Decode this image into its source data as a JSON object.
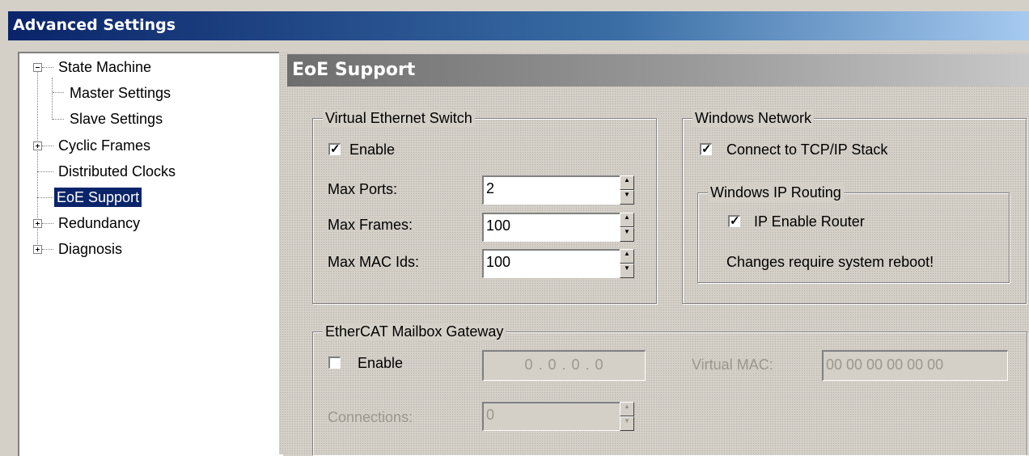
{
  "window": {
    "title": "Advanced Settings"
  },
  "tree": {
    "items": [
      {
        "label": "State Machine"
      },
      {
        "label": "Master Settings"
      },
      {
        "label": "Slave Settings"
      },
      {
        "label": "Cyclic Frames"
      },
      {
        "label": "Distributed Clocks"
      },
      {
        "label": "EoE Support"
      },
      {
        "label": "Redundancy"
      },
      {
        "label": "Diagnosis"
      }
    ]
  },
  "panel": {
    "title": "EoE Support"
  },
  "ves": {
    "title": "Virtual Ethernet Switch",
    "enable_label": "Enable",
    "enable_checked": true,
    "max_ports_label": "Max Ports:",
    "max_ports_value": "2",
    "max_frames_label": "Max Frames:",
    "max_frames_value": "100",
    "max_mac_label": "Max MAC Ids:",
    "max_mac_value": "100"
  },
  "winnet": {
    "title": "Windows Network",
    "connect_label": "Connect to TCP/IP Stack",
    "connect_checked": true,
    "routing_title": "Windows IP Routing",
    "router_label": "IP Enable Router",
    "router_checked": true,
    "note": "Changes require system reboot!"
  },
  "gateway": {
    "title": "EtherCAT Mailbox Gateway",
    "enable_label": "Enable",
    "enable_checked": false,
    "ip_value": "0 . 0 . 0 . 0",
    "virtual_mac_label": "Virtual MAC:",
    "virtual_mac_value": "00 00 00 00 00 00",
    "connections_label": "Connections:",
    "connections_value": "0"
  }
}
